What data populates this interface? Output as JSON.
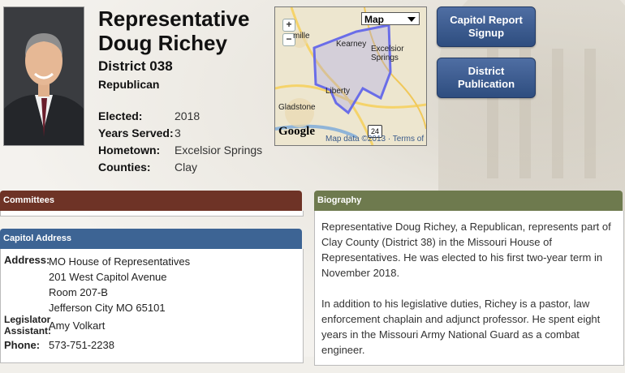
{
  "profile": {
    "name": "Representative\nDoug Richey",
    "district": "District 038",
    "party": "Republican",
    "facts": [
      {
        "label": "Elected:",
        "value": "2018"
      },
      {
        "label": "Years Served:",
        "value": "3"
      },
      {
        "label": "Hometown:",
        "value": "Excelsior Springs"
      },
      {
        "label": "Counties:",
        "value": "Clay"
      }
    ]
  },
  "map": {
    "type_selected": "Map",
    "zoom_in": "+",
    "zoom_out": "−",
    "labels": [
      "Kearney",
      "Excelsior Springs",
      "Liberty",
      "Gladstone",
      "mille"
    ],
    "route_shield": "24",
    "attribution": "Map data ©2013 · Terms of Use",
    "powered_by": "Google",
    "district_color": "#6a6de8"
  },
  "buttons": {
    "capitol_report": "Capitol Report\nSignup",
    "district_publication": "District\nPublication"
  },
  "panels": {
    "committees_title": "Committees",
    "capitol_title": "Capitol Address",
    "biography_title": "Biography"
  },
  "address": {
    "address_label": "Address:",
    "address_lines": [
      "MO House of Representatives",
      "201 West Capitol Avenue",
      "Room 207-B",
      "Jefferson City MO 65101"
    ],
    "assistant_label": "Legislator\nAssistant:",
    "assistant_value": "Amy Volkart",
    "phone_label": "Phone:",
    "phone_value": "573-751-2238"
  },
  "biography": {
    "paragraphs": [
      "Representative Doug Richey, a Republican, represents part of Clay County (District 38) in the Missouri House of Representatives. He was elected to his first two-year term in November 2018.",
      "In addition to his legislative duties, Richey is a pastor, law enforcement chaplain and adjunct professor. He spent eight years in the Missouri Army National Guard as a combat engineer."
    ]
  },
  "colors": {
    "committees": "#6e3326",
    "capitol": "#3d6494",
    "biography": "#6e7a4e",
    "button": "#3a5a8e"
  }
}
